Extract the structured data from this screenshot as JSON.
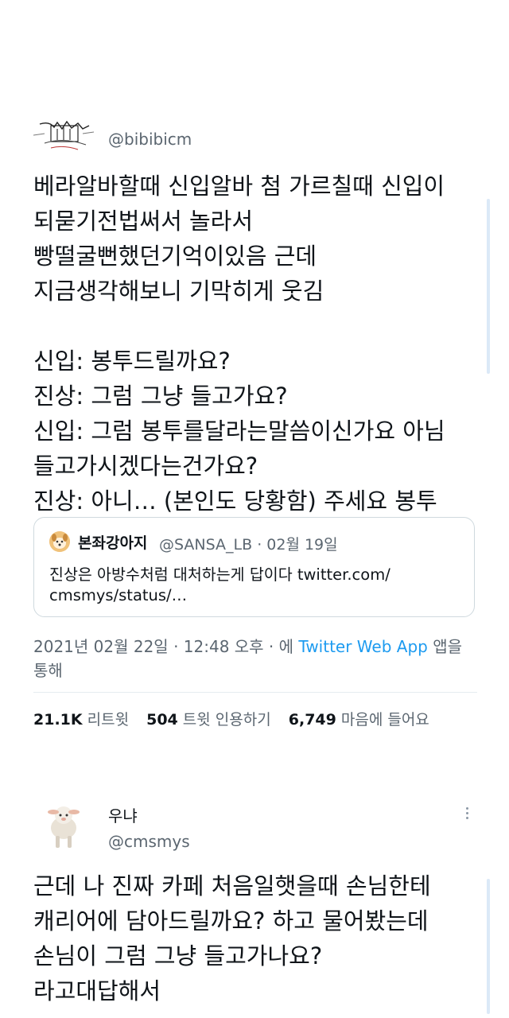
{
  "tweet1": {
    "handle": "@bibibicm",
    "lines": [
      "베라알바할때 신입알바 첨 가르칠때 신입이",
      "되묻기전법써서 놀라서",
      "빵떨굴뻔했던기억이있음 근데",
      "지금생각해보니 기막히게 웃김",
      "",
      "신입: 봉투드릴까요?",
      "진상: 그럼 그냥 들고가요?",
      "신입: 그럼 봉투를달라는말씀이신가요 아님",
      "들고가시겠다는건가요?",
      "진상: 아니… (본인도 당황함) 주세요 봉투"
    ],
    "quote": {
      "name": "본좌강아지",
      "meta": "@SANSA_LB · 02월 19일",
      "text_line1": "진상은 아방수처럼 대처하는게 답이다 twitter.com/",
      "text_line2": "cmsmys/status/…"
    },
    "timestamp": "2021년 02월 22일 · 12:48 오후 · 에",
    "source": "Twitter Web App",
    "source_suffix": "앱을",
    "timestamp_line2": "통해",
    "stats": {
      "retweets_count": "21.1K",
      "retweets_label": "리트윗",
      "quotes_count": "504",
      "quotes_label": "트윗 인용하기",
      "likes_count": "6,749",
      "likes_label": "마음에 들어요"
    }
  },
  "tweet2": {
    "name": "우냐",
    "handle": "@cmsmys",
    "lines": [
      "근데 나 진짜 카페 처음일햇을때 손님한테",
      "캐리어에 담아드릴까요? 하고 물어봤는데",
      "손님이 그럼 그냥 들고가나요?",
      "라고대답해서"
    ]
  },
  "colors": {
    "link": "#1d9bf0",
    "muted": "#5b6670",
    "text": "#0f1419"
  }
}
